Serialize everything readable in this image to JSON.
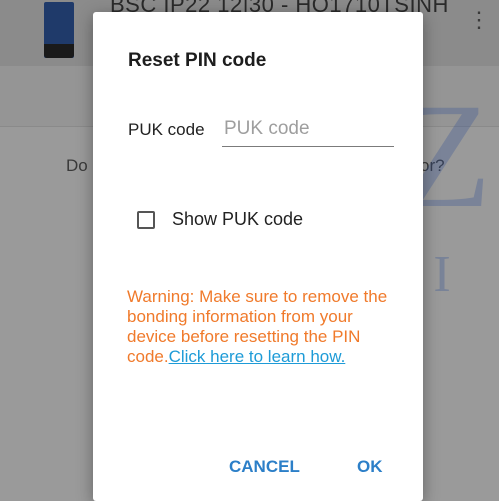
{
  "background": {
    "title": "BSC IP22 12|30 - HO1710TSINH",
    "prompt_left": "Do",
    "prompt_right": "or?"
  },
  "watermark": {
    "big": "AMZ",
    "small": "YACHTI"
  },
  "dialog": {
    "title": "Reset PIN code",
    "puk_label": "PUK code",
    "puk_placeholder": "PUK code",
    "puk_value": "",
    "show_puk_label": "Show PUK code",
    "show_puk_checked": false,
    "warning_text": "Warning: Make sure to remove the bonding information from your device before resetting the PIN code.",
    "warning_link": "Click here to learn how.",
    "cancel_label": "CANCEL",
    "ok_label": "OK"
  },
  "colors": {
    "warning": "#f07a2b",
    "link": "#1e9bd7",
    "button": "#2c7fc8"
  }
}
